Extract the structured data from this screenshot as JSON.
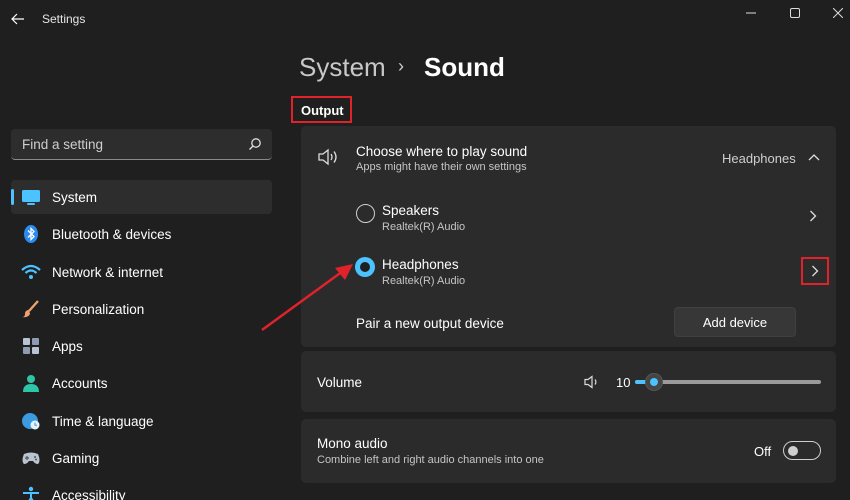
{
  "window": {
    "title": "Settings"
  },
  "search": {
    "placeholder": "Find a setting"
  },
  "sidebar": {
    "items": [
      {
        "label": "System",
        "icon": "system-icon",
        "active": true
      },
      {
        "label": "Bluetooth & devices",
        "icon": "bluetooth-icon"
      },
      {
        "label": "Network & internet",
        "icon": "wifi-icon"
      },
      {
        "label": "Personalization",
        "icon": "brush-icon"
      },
      {
        "label": "Apps",
        "icon": "apps-icon"
      },
      {
        "label": "Accounts",
        "icon": "account-icon"
      },
      {
        "label": "Time & language",
        "icon": "globe-clock-icon"
      },
      {
        "label": "Gaming",
        "icon": "gamepad-icon"
      },
      {
        "label": "Accessibility",
        "icon": "accessibility-icon"
      }
    ]
  },
  "header": {
    "parent": "System",
    "separator": "›",
    "title": "Sound"
  },
  "output": {
    "section_label": "Output",
    "choose": {
      "title": "Choose where to play sound",
      "subtitle": "Apps might have their own settings",
      "current": "Headphones"
    },
    "devices": [
      {
        "name": "Speakers",
        "detail": "Realtek(R) Audio",
        "selected": false
      },
      {
        "name": "Headphones",
        "detail": "Realtek(R) Audio",
        "selected": true
      }
    ],
    "pair": {
      "label": "Pair a new output device",
      "button": "Add device"
    }
  },
  "volume": {
    "label": "Volume",
    "value": "10",
    "level_percent": 10
  },
  "mono": {
    "title": "Mono audio",
    "subtitle": "Combine left and right audio channels into one",
    "state": "Off"
  },
  "colors": {
    "accent": "#4cc2ff",
    "annotation": "#e0222a"
  }
}
